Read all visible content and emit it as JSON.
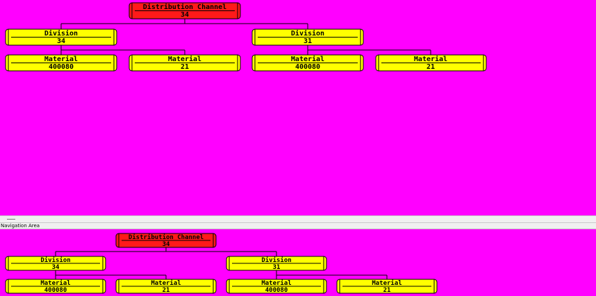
{
  "colors": {
    "background": "#ff00ff",
    "root_fill": "#ff1a1a",
    "child_fill": "#ffff00",
    "outline": "#000000"
  },
  "main_tree": {
    "root": {
      "label": "Distribution Channel",
      "value": "34"
    },
    "divisions": [
      {
        "label": "Division",
        "value": "34",
        "materials": [
          {
            "label": "Material",
            "value": "400080"
          },
          {
            "label": "Material",
            "value": "21"
          }
        ]
      },
      {
        "label": "Division",
        "value": "31",
        "materials": [
          {
            "label": "Material",
            "value": "400080"
          },
          {
            "label": "Material",
            "value": "21"
          }
        ]
      }
    ]
  },
  "navigation": {
    "label": "Navigation Area",
    "root": {
      "label": "Distribution Channel",
      "value": "34"
    },
    "divisions": [
      {
        "label": "Division",
        "value": "34",
        "materials": [
          {
            "label": "Material",
            "value": "400080"
          },
          {
            "label": "Material",
            "value": "21"
          }
        ]
      },
      {
        "label": "Division",
        "value": "31",
        "materials": [
          {
            "label": "Material",
            "value": "400080"
          },
          {
            "label": "Material",
            "value": "21"
          }
        ]
      }
    ]
  }
}
